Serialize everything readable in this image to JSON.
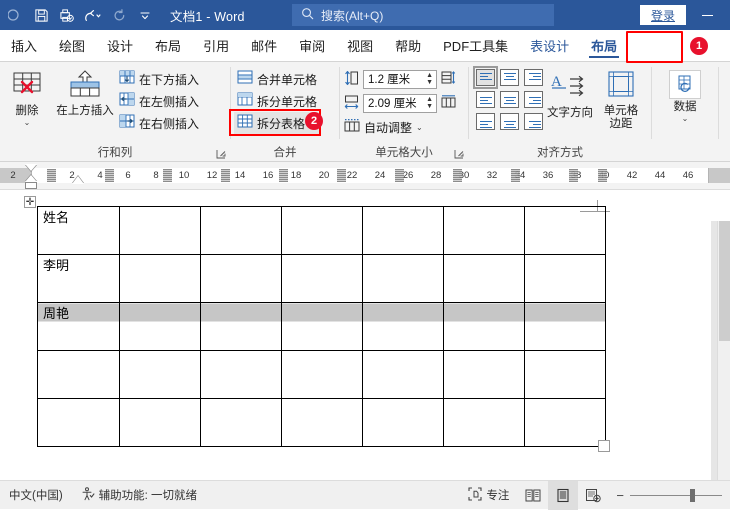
{
  "titlebar": {
    "doc_title": "文档1  -  Word",
    "search_placeholder": "搜索(Alt+Q)",
    "login_label": "登录",
    "qat": [
      {
        "name": "autosave-toggle-icon",
        "label": ""
      },
      {
        "name": "save-icon",
        "label": ""
      },
      {
        "name": "print-preview-icon",
        "label": ""
      },
      {
        "name": "undo-icon",
        "label": ""
      },
      {
        "name": "redo-icon",
        "label": ""
      },
      {
        "name": "customize-qat-icon",
        "label": ""
      }
    ],
    "minimize_label": "—",
    "accent_color": "#2b579a"
  },
  "tabs": [
    {
      "label": "插入",
      "state": "normal"
    },
    {
      "label": "绘图",
      "state": "normal"
    },
    {
      "label": "设计",
      "state": "normal"
    },
    {
      "label": "布局",
      "state": "normal"
    },
    {
      "label": "引用",
      "state": "normal"
    },
    {
      "label": "邮件",
      "state": "normal"
    },
    {
      "label": "审阅",
      "state": "normal"
    },
    {
      "label": "视图",
      "state": "normal"
    },
    {
      "label": "帮助",
      "state": "normal"
    },
    {
      "label": "PDF工具集",
      "state": "normal"
    },
    {
      "label": "表设计",
      "state": "contextual"
    },
    {
      "label": "布局",
      "state": "active"
    }
  ],
  "callouts": [
    {
      "number": "1",
      "target": "tab-layout-table",
      "color": "#e8112d"
    },
    {
      "number": "2",
      "target": "split-table-button",
      "color": "#e8112d"
    }
  ],
  "ribbon": {
    "groups": [
      {
        "name": "rows-and-columns",
        "label": "行和列",
        "has_dialog_launcher": true,
        "big_buttons": [
          {
            "label": "删除",
            "icon": "delete-table-icon",
            "has_caret": true
          },
          {
            "label": "在上方插入",
            "icon": "insert-above-icon",
            "has_caret": false
          }
        ],
        "small_items": [
          {
            "label": "在下方插入",
            "icon": "insert-below-icon"
          },
          {
            "label": "在左侧插入",
            "icon": "insert-left-icon"
          },
          {
            "label": "在右侧插入",
            "icon": "insert-right-icon"
          }
        ]
      },
      {
        "name": "merge",
        "label": "合并",
        "has_dialog_launcher": false,
        "small_items": [
          {
            "label": "合并单元格",
            "icon": "merge-cells-icon",
            "selected": false
          },
          {
            "label": "拆分单元格",
            "icon": "split-cells-icon",
            "selected": false
          },
          {
            "label": "拆分表格",
            "icon": "split-table-icon",
            "selected": true
          }
        ]
      },
      {
        "name": "cell-size",
        "label": "单元格大小",
        "has_dialog_launcher": true,
        "height_value": "1.2 厘米",
        "height_icon": "row-height-icon",
        "width_value": "2.09 厘米",
        "width_icon": "column-width-icon",
        "autofit_label": "自动调整",
        "autofit_icon": "autofit-icon",
        "distribute_rows_icon": "distribute-rows-icon",
        "distribute_cols_icon": "distribute-columns-icon"
      },
      {
        "name": "alignment",
        "label": "对齐方式",
        "has_dialog_launcher": false,
        "align_cells": [
          {
            "name": "align-top-left",
            "selected": true
          },
          {
            "name": "align-top-center",
            "selected": false
          },
          {
            "name": "align-top-right",
            "selected": false
          },
          {
            "name": "align-middle-left",
            "selected": false
          },
          {
            "name": "align-middle-center",
            "selected": false
          },
          {
            "name": "align-middle-right",
            "selected": false
          },
          {
            "name": "align-bottom-left",
            "selected": false
          },
          {
            "name": "align-bottom-center",
            "selected": false
          },
          {
            "name": "align-bottom-right",
            "selected": false
          }
        ],
        "text_direction_label": "文字方向",
        "cell_margin_label_1": "单元格",
        "cell_margin_label_2": "边距"
      },
      {
        "name": "data",
        "label": "",
        "button_label": "数据",
        "has_caret": true
      }
    ]
  },
  "ruler": {
    "unit": "",
    "ticks": [
      "2",
      "2",
      "4",
      "6",
      "8",
      "10",
      "12",
      "14",
      "16",
      "18",
      "20",
      "22",
      "24",
      "26",
      "28",
      "30",
      "32",
      "34",
      "36",
      "38",
      "40",
      "42",
      "44",
      "46"
    ]
  },
  "document": {
    "table": {
      "rows": 5,
      "cols": 7,
      "cells": [
        [
          "姓名",
          "",
          "",
          "",
          "",
          "",
          ""
        ],
        [
          "李明",
          "",
          "",
          "",
          "",
          "",
          ""
        ],
        [
          "周艳",
          "",
          "",
          "",
          "",
          "",
          ""
        ],
        [
          "",
          "",
          "",
          "",
          "",
          "",
          ""
        ],
        [
          "",
          "",
          "",
          "",
          "",
          "",
          ""
        ]
      ],
      "selected_row_index": 2
    }
  },
  "statusbar": {
    "language": "中文(中国)",
    "accessibility": "辅助功能: 一切就绪",
    "focus_label": "专注",
    "views": [
      {
        "name": "read-mode-view",
        "active": false
      },
      {
        "name": "print-layout-view",
        "active": true
      },
      {
        "name": "web-layout-view",
        "active": false
      }
    ],
    "zoom_minus": "−",
    "zoom_plus": ""
  }
}
